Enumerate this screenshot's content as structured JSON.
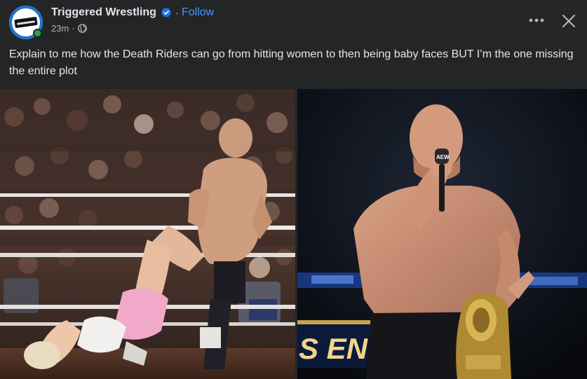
{
  "header": {
    "page_name": "Triggered Wrestling",
    "separator": "·",
    "follow_label": "Follow",
    "timestamp": "23m",
    "meta_separator": "·",
    "privacy_icon": "globe-icon",
    "more_icon": "more-horizontal-icon",
    "close_icon": "close-icon",
    "verified_icon": "verified-badge-icon"
  },
  "post": {
    "caption": "Explain to me how the Death Riders can go from hitting women to then being baby faces BUT I’m the one missing the entire plot"
  },
  "media": {
    "right_banner_text": "S END"
  },
  "colors": {
    "background": "#242526",
    "text_primary": "#e4e6eb",
    "text_secondary": "#b0b3b8",
    "link": "#4599ff",
    "verified": "#1b74e4",
    "online": "#31a24c"
  }
}
